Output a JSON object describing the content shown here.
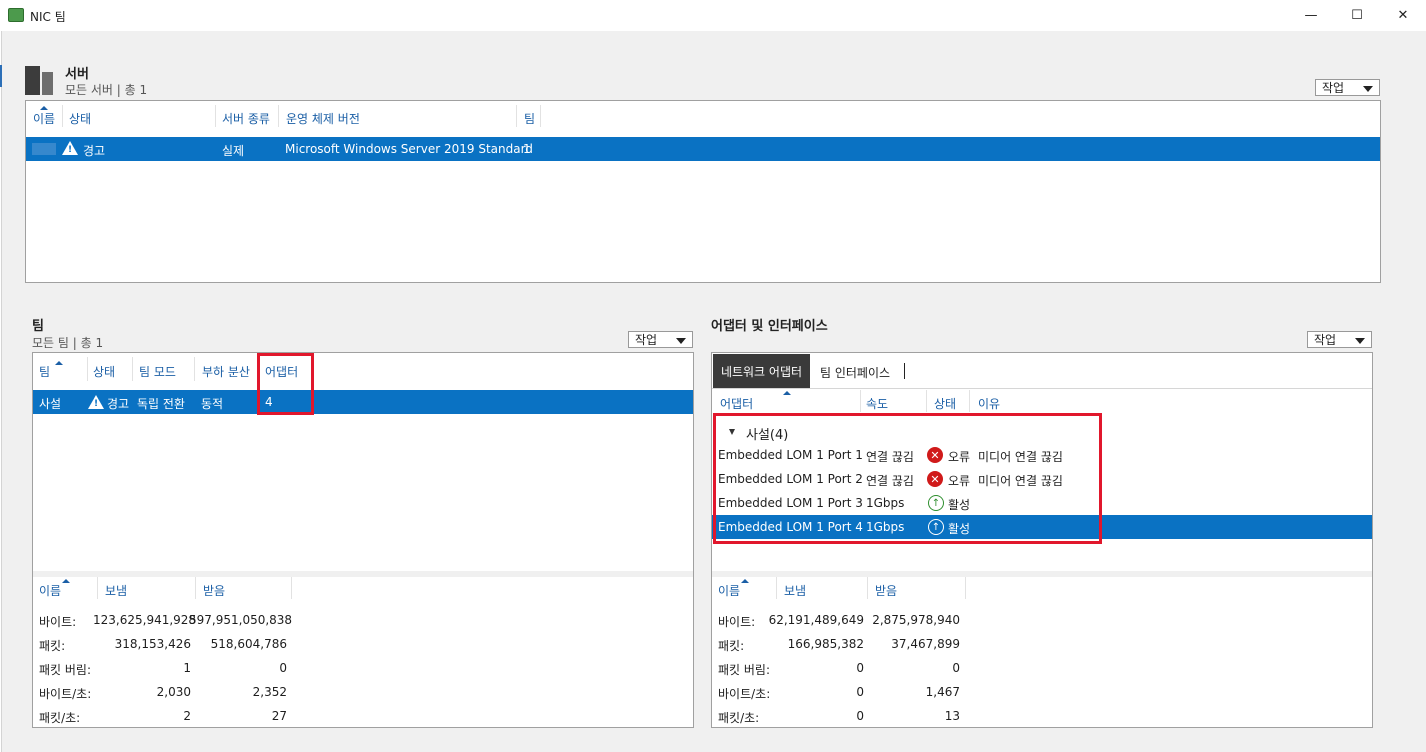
{
  "window": {
    "title": "NIC 팀",
    "minimize": "—",
    "maximize": "☐",
    "close": "✕"
  },
  "servers": {
    "title": "서버",
    "subtitle": "모든 서버 | 총 1",
    "action": "작업",
    "columns": [
      "이름",
      "상태",
      "서버 종류",
      "운영 체제 버전",
      "팀"
    ],
    "row": {
      "status": "경고",
      "type": "실제",
      "os": "Microsoft Windows Server 2019 Standard",
      "teams": "1"
    }
  },
  "teams": {
    "title": "팀",
    "subtitle": "모든 팀 | 총 1",
    "action": "작업",
    "columns": [
      "팀",
      "상태",
      "팀 모드",
      "부하 분산",
      "어댑터"
    ],
    "row": {
      "name": "사설",
      "status": "경고",
      "mode": "독립 전환",
      "lb": "동적",
      "adapters": "4"
    },
    "stats_columns": [
      "이름",
      "보냄",
      "받음"
    ],
    "stats": [
      {
        "name": "바이트:",
        "sent": "123,625,941,928",
        "recv": "597,951,050,838"
      },
      {
        "name": "패킷:",
        "sent": "318,153,426",
        "recv": "518,604,786"
      },
      {
        "name": "패킷 버림:",
        "sent": "1",
        "recv": "0"
      },
      {
        "name": "바이트/초:",
        "sent": "2,030",
        "recv": "2,352"
      },
      {
        "name": "패킷/초:",
        "sent": "2",
        "recv": "27"
      }
    ]
  },
  "adapters": {
    "title": "어댑터 및 인터페이스",
    "action": "작업",
    "tabs": [
      "네트워크 어댑터",
      "팀 인터페이스"
    ],
    "columns": [
      "어댑터",
      "속도",
      "상태",
      "이유"
    ],
    "group": "사설(4)",
    "rows": [
      {
        "name": "Embedded LOM 1 Port 1",
        "speed": "연결 끊김",
        "state": "오류",
        "reason": "미디어 연결 끊김"
      },
      {
        "name": "Embedded LOM 1 Port 2",
        "speed": "연결 끊김",
        "state": "오류",
        "reason": "미디어 연결 끊김"
      },
      {
        "name": "Embedded LOM 1 Port 3",
        "speed": "1Gbps",
        "state": "활성",
        "reason": ""
      },
      {
        "name": "Embedded LOM 1 Port 4",
        "speed": "1Gbps",
        "state": "활성",
        "reason": ""
      }
    ],
    "stats_columns": [
      "이름",
      "보냄",
      "받음"
    ],
    "stats": [
      {
        "name": "바이트:",
        "sent": "62,191,489,649",
        "recv": "2,875,978,940"
      },
      {
        "name": "패킷:",
        "sent": "166,985,382",
        "recv": "37,467,899"
      },
      {
        "name": "패킷 버림:",
        "sent": "0",
        "recv": "0"
      },
      {
        "name": "바이트/초:",
        "sent": "0",
        "recv": "1,467"
      },
      {
        "name": "패킷/초:",
        "sent": "0",
        "recv": "13"
      }
    ]
  },
  "colors": {
    "accent": "#0a72c3",
    "highlight": "#e1172c",
    "header_text": "#1b5fa6"
  }
}
